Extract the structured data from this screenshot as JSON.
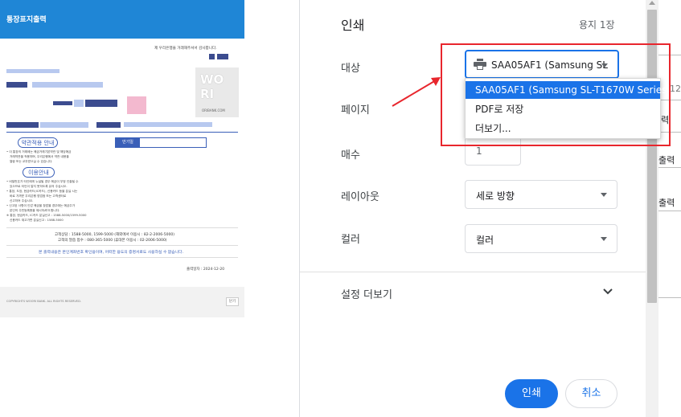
{
  "preview": {
    "header_title": "통장표지출력",
    "greeting_line": "제 우리은행을 거래해주셔서 감사합니다.",
    "logo_line1": "WO",
    "logo_line2": "RI",
    "logo_domain": "ORIBANK.COM",
    "guide_pill": "약관적용 안내",
    "usage_pill": "이용안내",
    "rate_label": "만기일",
    "guide_text_1": "• 이 통장의 거래에는 예금거래기본약관 및 해당예금",
    "guide_text_2": "거래약관을 적용하며, 우리은행에서 약관 내용을",
    "guide_text_3": "열람 또는 교부받으실 수 있습니다.",
    "usage_text_1": "• 비밀번호가 타인에게 누설될 경우 예금이 부정 인출될 수",
    "usage_text_2": "있으므로 타인이 알지 못하도록 유의 주십시오.",
    "usage_text_3": "• 통장, 도장, 현금카드(IC카드), 신용카드 등을 분실 시는",
    "usage_text_4": "바로 가까운 우리은행 영업점 또는 고객센터로",
    "usage_text_5": "신고하여 주십시오.",
    "usage_text_6": "• 신고된 사항이 인감 예금을 찾았을 경우에는 예금주가",
    "usage_text_7": "본인의 주민등록증을 제시하셔야 합니다.",
    "usage_text_8": "※ 통장, 현금카드, IC카드 분실신고 : 1588-5000/1599-5000",
    "usage_text_9": "신용카드 재고가면 분실신고 : 1588-5000",
    "contact_1": "고객상담 : 1588-5000, 1599-5000 (해외에서 이용시 : 82-2-2006-5000)",
    "contact_2": "고객의 말씀 접수 : 080-365-5000 (휴대폰 이용시 : 02-2006-5000)",
    "notice": "본 출력내용은 본인계좌번호 확인용이며, 어떠한 용도의 증명서로도 사용하실 수 없습니다.",
    "output_date": "출력일자 : 2024-12-20",
    "copyright": "COPYRIGHTS WOORI BANK. ALL RIGHTS RESERVED.",
    "close_label": "닫기"
  },
  "panel": {
    "title": "인쇄",
    "sheet_count": "용지 1장",
    "destination_label": "대상",
    "destination_value": "SAA05AF1 (Samsung SL",
    "destination_options": [
      "SAA05AF1 (Samsung SL-T1670W Series)",
      "PDF로 저장",
      "더보기..."
    ],
    "pages_label": "페이지",
    "copies_label": "매수",
    "copies_value": "1",
    "layout_label": "레이아웃",
    "layout_value": "세로 방향",
    "color_label": "컬러",
    "color_value": "컬러",
    "more_settings_label": "설정 더보기",
    "print_button": "인쇄",
    "cancel_button": "취소"
  },
  "right_strip": {
    "text_1": "12",
    "text_2": "력",
    "text_3": "출력",
    "text_4": "출력"
  },
  "colors": {
    "accent": "#1a73e8",
    "highlight": "#e8262d",
    "preview_header": "#1f86d6"
  },
  "icons": {
    "printer": "printer-icon",
    "caret": "caret-down-icon",
    "chevron": "chevron-down-icon",
    "arrow": "red-arrow-annotation"
  }
}
